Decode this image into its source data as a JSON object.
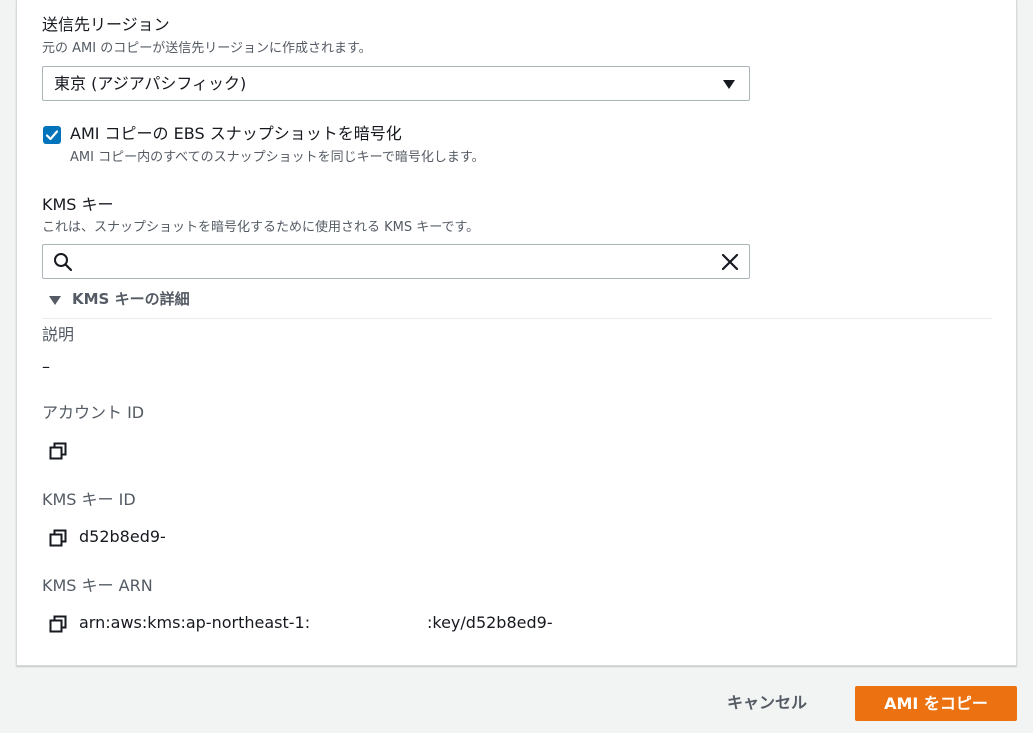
{
  "destination_region": {
    "label": "送信先リージョン",
    "description": "元の AMI のコピーが送信先リージョンに作成されます。",
    "selected_value": "東京 (アジアパシフィック)"
  },
  "encrypt": {
    "checked": true,
    "label": "AMI コピーの EBS スナップショットを暗号化",
    "description": "AMI コピー内のすべてのスナップショットを同じキーで暗号化します。"
  },
  "kms_key": {
    "label": "KMS キー",
    "description": "これは、スナップショットを暗号化するために使用される KMS キーです。",
    "search_value": ""
  },
  "kms_details": {
    "title": "KMS キーの詳細",
    "description_label": "説明",
    "description_value": "–",
    "account_id_label": "アカウント ID",
    "account_id_value": "",
    "key_id_label": "KMS キー ID",
    "key_id_value": "d52b8ed9-",
    "arn_label": "KMS キー ARN",
    "arn_prefix": "arn:aws:kms:ap-northeast-1:",
    "arn_suffix": ":key/d52b8ed9-"
  },
  "footer": {
    "cancel_label": "キャンセル",
    "copy_label": "AMI をコピー"
  },
  "colors": {
    "primary": "#ec7211",
    "checkbox": "#0073bb",
    "background": "#f2f3f3"
  }
}
